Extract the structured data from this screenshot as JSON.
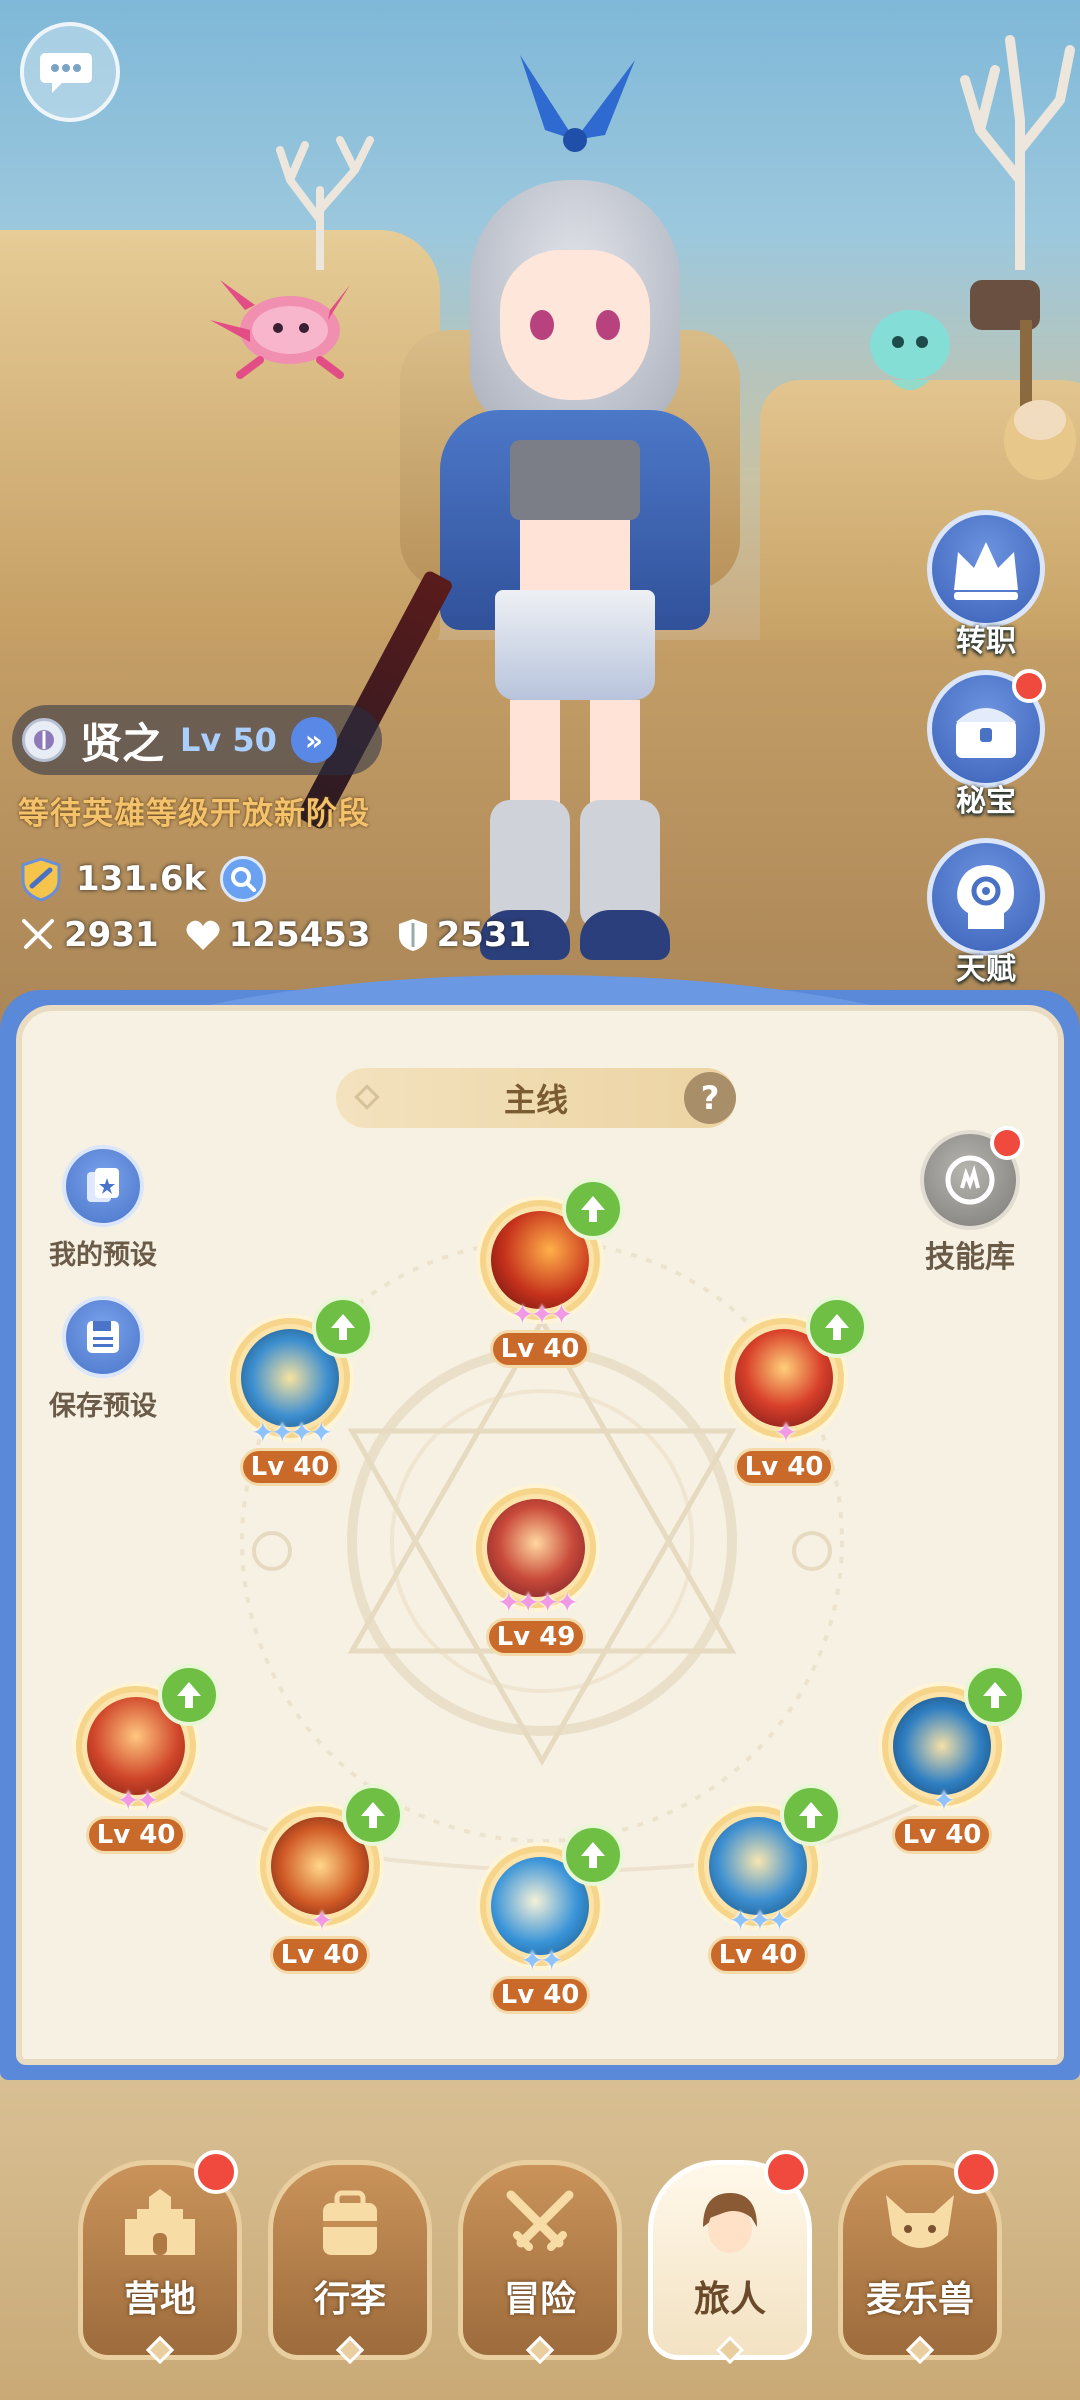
{
  "hero": {
    "name": "贤之",
    "level": "Lv 50",
    "hint": "等待英雄等级开放新阶段",
    "power": "131.6k",
    "attack": "2931",
    "hp": "125453",
    "defense": "2531"
  },
  "side_buttons": [
    {
      "label": "转职",
      "icon": "crown-icon",
      "badge": false
    },
    {
      "label": "秘宝",
      "icon": "treasure-chest-icon",
      "badge": true
    },
    {
      "label": "天赋",
      "icon": "brain-icon",
      "badge": false
    }
  ],
  "panel": {
    "title": "主线",
    "my_preset": "我的预设",
    "save_preset": "保存预设",
    "skill_library": "技能库"
  },
  "skills": [
    {
      "level": "Lv 40",
      "stars": 3,
      "star_color": "pink",
      "upgrade": true
    },
    {
      "level": "Lv 40",
      "stars": 4,
      "star_color": "blue",
      "upgrade": true
    },
    {
      "level": "Lv 40",
      "stars": 1,
      "star_color": "pink",
      "upgrade": true
    },
    {
      "level": "Lv 49",
      "stars": 4,
      "star_color": "pink",
      "upgrade": false
    },
    {
      "level": "Lv 40",
      "stars": 2,
      "star_color": "pink",
      "upgrade": true
    },
    {
      "level": "Lv 40",
      "stars": 1,
      "star_color": "pink",
      "upgrade": true
    },
    {
      "level": "Lv 40",
      "stars": 2,
      "star_color": "blue",
      "upgrade": true
    },
    {
      "level": "Lv 40",
      "stars": 3,
      "star_color": "blue",
      "upgrade": true
    },
    {
      "level": "Lv 40",
      "stars": 1,
      "star_color": "blue",
      "upgrade": true
    }
  ],
  "nav": [
    {
      "label": "营地",
      "icon": "castle-icon",
      "badge": true,
      "active": false
    },
    {
      "label": "行李",
      "icon": "backpack-icon",
      "badge": false,
      "active": false
    },
    {
      "label": "冒险",
      "icon": "crossed-swords-icon",
      "badge": false,
      "active": false
    },
    {
      "label": "旅人",
      "icon": "traveler-avatar-icon",
      "badge": true,
      "active": true
    },
    {
      "label": "麦乐兽",
      "icon": "pet-cat-icon",
      "badge": true,
      "active": false
    }
  ],
  "colors": {
    "panel_blue": "#5b89d9",
    "level_badge": "#c96a2a",
    "upgrade_green": "#6fbf45",
    "hint_gold": "#f3c26b",
    "badge_red": "#f0493e"
  }
}
